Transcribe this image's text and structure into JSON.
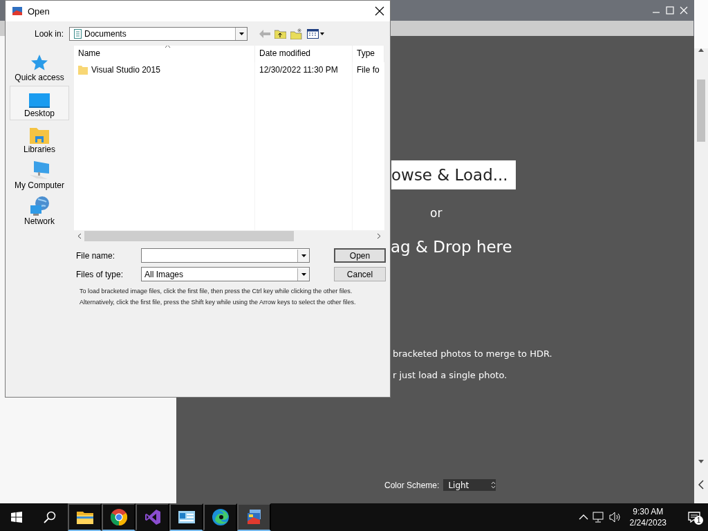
{
  "app": {
    "browse_button": "owse & Load...",
    "or_text": "or",
    "drop_text": "ag & Drop here",
    "info": [
      "bracketed photos to merge to HDR.",
      "r just load a single photo."
    ],
    "color_scheme": {
      "label": "Color Scheme:",
      "value": "Light"
    }
  },
  "dialog": {
    "title": "Open",
    "look_in": {
      "label": "Look in:",
      "value": "Documents"
    },
    "places": [
      {
        "kind": "star",
        "label": "Quick access",
        "selected": false
      },
      {
        "kind": "desktop",
        "label": "Desktop",
        "selected": true
      },
      {
        "kind": "libraries",
        "label": "Libraries",
        "selected": false
      },
      {
        "kind": "computer",
        "label": "My Computer",
        "selected": false
      },
      {
        "kind": "network",
        "label": "Network",
        "selected": false
      }
    ],
    "columns": [
      "Name",
      "Date modified",
      "Type"
    ],
    "rows": [
      {
        "name": "Visual Studio 2015",
        "date_modified": "12/30/2022 11:30 PM",
        "type": "File fo"
      }
    ],
    "file_name": {
      "label": "File name:"
    },
    "file_type": {
      "label": "Files of type:",
      "value": "All Images"
    },
    "buttons": [
      "Open",
      "Cancel"
    ],
    "hint": [
      "To load bracketed image files, click the first file, then press the Ctrl key while clicking the other files.",
      "Alternatively, click the first file, press the Shift key while using the Arrow keys to select the other files."
    ]
  },
  "taskbar": {
    "apps": [
      {
        "kind": "explorer",
        "running": true,
        "selected": false
      },
      {
        "kind": "chrome",
        "running": true,
        "selected": false
      },
      {
        "kind": "studio",
        "running": false,
        "selected": false
      },
      {
        "kind": "card",
        "running": true,
        "selected": false
      },
      {
        "kind": "edge",
        "running": false,
        "selected": false
      },
      {
        "kind": "photo",
        "running": true,
        "selected": true
      }
    ],
    "time": "9:30 AM",
    "date": "2/24/2023",
    "notifications": "1"
  }
}
